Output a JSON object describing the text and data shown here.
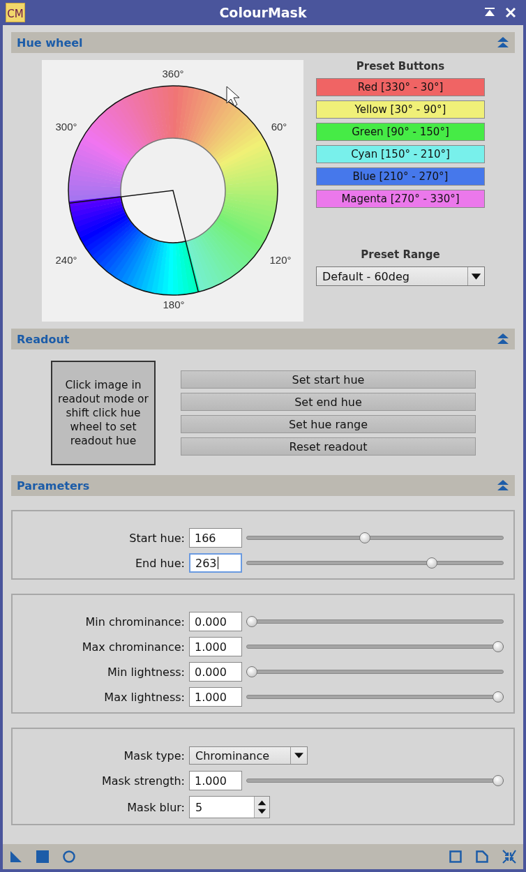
{
  "window": {
    "app_icon": "CM",
    "title": "ColourMask"
  },
  "hue_wheel": {
    "header": "Hue wheel",
    "wheel_labels": [
      "360°",
      "60°",
      "120°",
      "180°",
      "240°",
      "300°"
    ],
    "presets_title": "Preset Buttons",
    "presets": [
      {
        "label": "Red [330° - 30°]",
        "color": "#f06464"
      },
      {
        "label": "Yellow [30° - 90°]",
        "color": "#f0f078"
      },
      {
        "label": "Green [90° - 150°]",
        "color": "#46eb46"
      },
      {
        "label": "Cyan [150° - 210°]",
        "color": "#78f0eb"
      },
      {
        "label": "Blue [210° - 270°]",
        "color": "#4678eb"
      },
      {
        "label": "Magenta [270° - 330°]",
        "color": "#eb78eb"
      }
    ],
    "preset_range_title": "Preset Range",
    "preset_range": "Default - 60deg"
  },
  "readout": {
    "header": "Readout",
    "hint": "Click image in readout mode or shift click hue wheel to set readout hue",
    "buttons": [
      "Set start hue",
      "Set end hue",
      "Set hue range",
      "Reset readout"
    ]
  },
  "parameters": {
    "header": "Parameters",
    "groups": [
      [
        {
          "kind": "slider",
          "label": "Start hue:",
          "value": "166",
          "level": 0.46,
          "focused": false
        },
        {
          "kind": "slider",
          "label": "End hue:",
          "value": "263",
          "level": 0.73,
          "focused": true
        }
      ],
      [
        {
          "kind": "slider",
          "label": "Min chrominance:",
          "value": "0.000",
          "level": 0,
          "focused": false
        },
        {
          "kind": "slider",
          "label": "Max chrominance:",
          "value": "1.000",
          "level": 1,
          "focused": false
        },
        {
          "kind": "slider",
          "label": "Min lightness:",
          "value": "0.000",
          "level": 0,
          "focused": false
        },
        {
          "kind": "slider",
          "label": "Max lightness:",
          "value": "1.000",
          "level": 1,
          "focused": false
        }
      ],
      [
        {
          "kind": "dropdown",
          "label": "Mask type:",
          "value": "Chrominance"
        },
        {
          "kind": "slider",
          "label": "Mask strength:",
          "value": "1.000",
          "level": 1,
          "focused": false
        },
        {
          "kind": "spin",
          "label": "Mask blur:",
          "value": "5"
        }
      ]
    ]
  }
}
